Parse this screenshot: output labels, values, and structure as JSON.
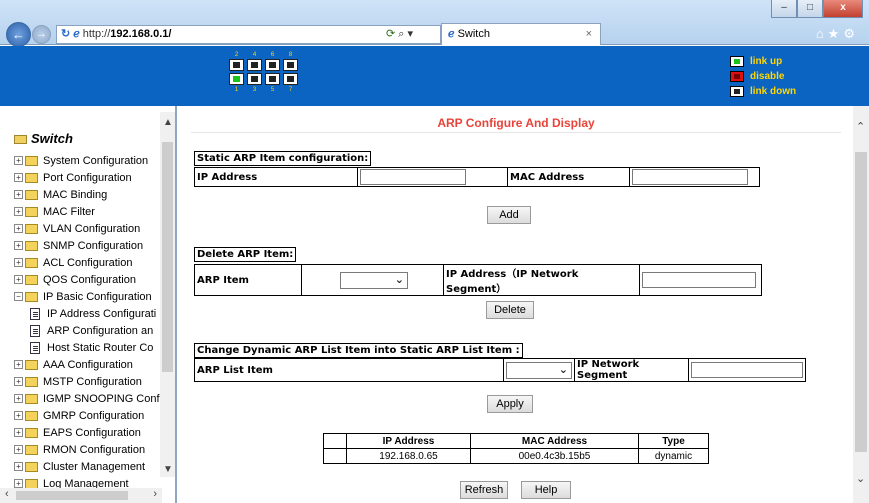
{
  "browser": {
    "url_prefix": "http://",
    "url_host": "192.168.0.1/",
    "tab_title": "Switch",
    "tab_close": "×",
    "win_minimize": "–",
    "win_maximize": "□",
    "win_close": "x",
    "back": "←",
    "forward": "→",
    "toolbar_icons": "⌂★⚙"
  },
  "header": {
    "port_numbers_top": [
      "2",
      "4",
      "6",
      "8"
    ],
    "port_numbers_bottom": [
      "1",
      "3",
      "5",
      "7"
    ],
    "legend": [
      "link up",
      "disable",
      "link down"
    ]
  },
  "sidebar": {
    "root": "Switch",
    "items": [
      "System Configuration",
      "Port Configuration",
      "MAC Binding",
      "MAC Filter",
      "VLAN Configuration",
      "SNMP Configuration",
      "ACL Configuration",
      "QOS Configuration",
      "IP Basic Configuration",
      "IP Address Configurati",
      "ARP Configuration an",
      "Host Static Router Co",
      "AAA Configuration",
      "MSTP Configuration",
      "IGMP SNOOPING Confi",
      "GMRP Configuration",
      "EAPS Configuration",
      "RMON Configuration",
      "Cluster Management",
      "Log Management"
    ]
  },
  "main": {
    "title": "ARP Configure And Display",
    "static_section": {
      "label": "Static ARP Item configuration:",
      "ip_label": "IP Address",
      "ip_value": "",
      "mac_label": "MAC Address",
      "mac_value": "",
      "add_button": "Add"
    },
    "delete_section": {
      "label": "Delete ARP Item:",
      "arp_item_label": "ARP Item",
      "arp_item_value": "",
      "ip_label": "IP Address（IP Network Segment）",
      "ip_value": "",
      "delete_button": "Delete"
    },
    "change_section": {
      "label": "Change Dynamic ARP List Item into Static ARP List Item :",
      "list_item_label": "ARP List Item",
      "list_item_value": "",
      "segment_label": "IP Network Segment",
      "segment_value": "",
      "apply_button": "Apply"
    },
    "arp_table": {
      "columns": [
        "",
        "IP Address",
        "MAC Address",
        "Type"
      ],
      "rows": [
        {
          "ip": "192.168.0.65",
          "mac": "00e0.4c3b.15b5",
          "type": "dynamic"
        }
      ]
    },
    "refresh_button": "Refresh",
    "help_button": "Help"
  }
}
